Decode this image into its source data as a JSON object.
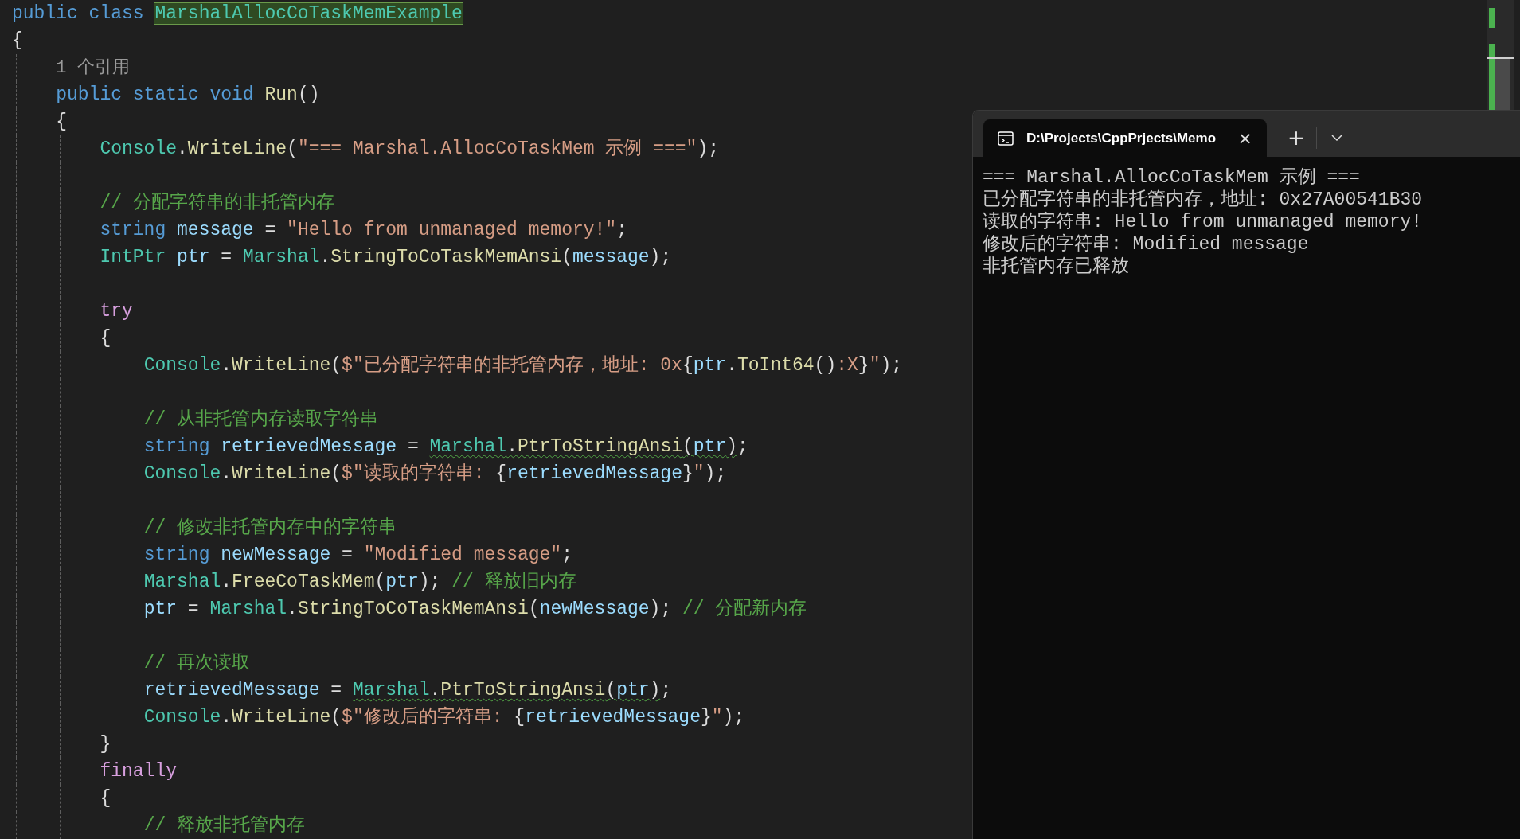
{
  "editor": {
    "lines": [
      {
        "kind": "code",
        "tokens": [
          {
            "kind": "kw",
            "text": "public class "
          },
          {
            "kind": "type",
            "text": "MarshalAllocCoTaskMemExample",
            "highlighted": true
          }
        ]
      },
      {
        "kind": "code",
        "tokens": [
          {
            "kind": "plain",
            "text": "{"
          }
        ],
        "children": [
          {
            "kind": "codelens",
            "text": "1 个引用"
          },
          {
            "kind": "code",
            "tokens": [
              {
                "kind": "kw",
                "text": "public static void "
              },
              {
                "kind": "fn",
                "text": "Run"
              },
              {
                "kind": "plain",
                "text": "()"
              }
            ]
          },
          {
            "kind": "code",
            "tokens": [
              {
                "kind": "plain",
                "text": "{"
              }
            ],
            "children": [
              {
                "kind": "code",
                "tokens": [
                  {
                    "kind": "type",
                    "text": "Console"
                  },
                  {
                    "kind": "plain",
                    "text": "."
                  },
                  {
                    "kind": "fn",
                    "text": "WriteLine"
                  },
                  {
                    "kind": "plain",
                    "text": "("
                  },
                  {
                    "kind": "str",
                    "text": "\"=== Marshal.AllocCoTaskMem 示例 ===\""
                  },
                  {
                    "kind": "plain",
                    "text": ");"
                  }
                ]
              },
              {
                "kind": "blank"
              },
              {
                "kind": "code",
                "tokens": [
                  {
                    "kind": "cmt",
                    "text": "// 分配字符串的非托管内存"
                  }
                ]
              },
              {
                "kind": "code",
                "tokens": [
                  {
                    "kind": "kw",
                    "text": "string "
                  },
                  {
                    "kind": "var",
                    "text": "message"
                  },
                  {
                    "kind": "plain",
                    "text": " = "
                  },
                  {
                    "kind": "str",
                    "text": "\"Hello from unmanaged memory!\""
                  },
                  {
                    "kind": "plain",
                    "text": ";"
                  }
                ]
              },
              {
                "kind": "code",
                "tokens": [
                  {
                    "kind": "type",
                    "text": "IntPtr "
                  },
                  {
                    "kind": "var",
                    "text": "ptr"
                  },
                  {
                    "kind": "plain",
                    "text": " = "
                  },
                  {
                    "kind": "type",
                    "text": "Marshal"
                  },
                  {
                    "kind": "plain",
                    "text": "."
                  },
                  {
                    "kind": "fn",
                    "text": "StringToCoTaskMemAnsi"
                  },
                  {
                    "kind": "plain",
                    "text": "("
                  },
                  {
                    "kind": "var",
                    "text": "message"
                  },
                  {
                    "kind": "plain",
                    "text": ");"
                  }
                ]
              },
              {
                "kind": "blank"
              },
              {
                "kind": "code",
                "tokens": [
                  {
                    "kind": "ctl",
                    "text": "try"
                  }
                ]
              },
              {
                "kind": "code",
                "tokens": [
                  {
                    "kind": "plain",
                    "text": "{"
                  }
                ],
                "children": [
                  {
                    "kind": "code",
                    "tokens": [
                      {
                        "kind": "type",
                        "text": "Console"
                      },
                      {
                        "kind": "plain",
                        "text": "."
                      },
                      {
                        "kind": "fn",
                        "text": "WriteLine"
                      },
                      {
                        "kind": "plain",
                        "text": "("
                      },
                      {
                        "kind": "str",
                        "text": "$\"已分配字符串的非托管内存，地址: 0x"
                      },
                      {
                        "kind": "plain",
                        "text": "{"
                      },
                      {
                        "kind": "var",
                        "text": "ptr"
                      },
                      {
                        "kind": "plain",
                        "text": "."
                      },
                      {
                        "kind": "fn",
                        "text": "ToInt64"
                      },
                      {
                        "kind": "plain",
                        "text": "()"
                      },
                      {
                        "kind": "str",
                        "text": ":X"
                      },
                      {
                        "kind": "plain",
                        "text": "}"
                      },
                      {
                        "kind": "str",
                        "text": "\""
                      },
                      {
                        "kind": "plain",
                        "text": ");"
                      }
                    ]
                  },
                  {
                    "kind": "blank"
                  },
                  {
                    "kind": "code",
                    "tokens": [
                      {
                        "kind": "cmt",
                        "text": "// 从非托管内存读取字符串"
                      }
                    ]
                  },
                  {
                    "kind": "code",
                    "tokens": [
                      {
                        "kind": "kw",
                        "text": "string "
                      },
                      {
                        "kind": "var",
                        "text": "retrievedMessage"
                      },
                      {
                        "kind": "plain",
                        "text": " = "
                      },
                      {
                        "kind": "type",
                        "text": "Marshal",
                        "squiggle": true
                      },
                      {
                        "kind": "plain",
                        "text": ".",
                        "squiggle": true
                      },
                      {
                        "kind": "fn",
                        "text": "PtrToStringAnsi",
                        "squiggle": true
                      },
                      {
                        "kind": "plain",
                        "text": "(",
                        "squiggle": true
                      },
                      {
                        "kind": "var",
                        "text": "ptr",
                        "squiggle": true
                      },
                      {
                        "kind": "plain",
                        "text": ")",
                        "squiggle": true
                      },
                      {
                        "kind": "plain",
                        "text": ";"
                      }
                    ]
                  },
                  {
                    "kind": "code",
                    "tokens": [
                      {
                        "kind": "type",
                        "text": "Console"
                      },
                      {
                        "kind": "plain",
                        "text": "."
                      },
                      {
                        "kind": "fn",
                        "text": "WriteLine"
                      },
                      {
                        "kind": "plain",
                        "text": "("
                      },
                      {
                        "kind": "str",
                        "text": "$\"读取的字符串: "
                      },
                      {
                        "kind": "plain",
                        "text": "{"
                      },
                      {
                        "kind": "var",
                        "text": "retrievedMessage"
                      },
                      {
                        "kind": "plain",
                        "text": "}"
                      },
                      {
                        "kind": "str",
                        "text": "\""
                      },
                      {
                        "kind": "plain",
                        "text": ");"
                      }
                    ]
                  },
                  {
                    "kind": "blank"
                  },
                  {
                    "kind": "code",
                    "tokens": [
                      {
                        "kind": "cmt",
                        "text": "// 修改非托管内存中的字符串"
                      }
                    ]
                  },
                  {
                    "kind": "code",
                    "tokens": [
                      {
                        "kind": "kw",
                        "text": "string "
                      },
                      {
                        "kind": "var",
                        "text": "newMessage"
                      },
                      {
                        "kind": "plain",
                        "text": " = "
                      },
                      {
                        "kind": "str",
                        "text": "\"Modified message\""
                      },
                      {
                        "kind": "plain",
                        "text": ";"
                      }
                    ]
                  },
                  {
                    "kind": "code",
                    "tokens": [
                      {
                        "kind": "type",
                        "text": "Marshal"
                      },
                      {
                        "kind": "plain",
                        "text": "."
                      },
                      {
                        "kind": "fn",
                        "text": "FreeCoTaskMem"
                      },
                      {
                        "kind": "plain",
                        "text": "("
                      },
                      {
                        "kind": "var",
                        "text": "ptr"
                      },
                      {
                        "kind": "plain",
                        "text": "); "
                      },
                      {
                        "kind": "cmt",
                        "text": "// 释放旧内存"
                      }
                    ]
                  },
                  {
                    "kind": "code",
                    "tokens": [
                      {
                        "kind": "var",
                        "text": "ptr"
                      },
                      {
                        "kind": "plain",
                        "text": " = "
                      },
                      {
                        "kind": "type",
                        "text": "Marshal"
                      },
                      {
                        "kind": "plain",
                        "text": "."
                      },
                      {
                        "kind": "fn",
                        "text": "StringToCoTaskMemAnsi"
                      },
                      {
                        "kind": "plain",
                        "text": "("
                      },
                      {
                        "kind": "var",
                        "text": "newMessage"
                      },
                      {
                        "kind": "plain",
                        "text": "); "
                      },
                      {
                        "kind": "cmt",
                        "text": "// 分配新内存"
                      }
                    ]
                  },
                  {
                    "kind": "blank"
                  },
                  {
                    "kind": "code",
                    "tokens": [
                      {
                        "kind": "cmt",
                        "text": "// 再次读取"
                      }
                    ]
                  },
                  {
                    "kind": "code",
                    "tokens": [
                      {
                        "kind": "var",
                        "text": "retrievedMessage"
                      },
                      {
                        "kind": "plain",
                        "text": " = "
                      },
                      {
                        "kind": "type",
                        "text": "Marshal",
                        "squiggle": true
                      },
                      {
                        "kind": "plain",
                        "text": ".",
                        "squiggle": true
                      },
                      {
                        "kind": "fn",
                        "text": "PtrToStringAnsi",
                        "squiggle": true
                      },
                      {
                        "kind": "plain",
                        "text": "(",
                        "squiggle": true
                      },
                      {
                        "kind": "var",
                        "text": "ptr",
                        "squiggle": true
                      },
                      {
                        "kind": "plain",
                        "text": ")",
                        "squiggle": true
                      },
                      {
                        "kind": "plain",
                        "text": ";"
                      }
                    ]
                  },
                  {
                    "kind": "code",
                    "tokens": [
                      {
                        "kind": "type",
                        "text": "Console"
                      },
                      {
                        "kind": "plain",
                        "text": "."
                      },
                      {
                        "kind": "fn",
                        "text": "WriteLine"
                      },
                      {
                        "kind": "plain",
                        "text": "("
                      },
                      {
                        "kind": "str",
                        "text": "$\"修改后的字符串: "
                      },
                      {
                        "kind": "plain",
                        "text": "{"
                      },
                      {
                        "kind": "var",
                        "text": "retrievedMessage"
                      },
                      {
                        "kind": "plain",
                        "text": "}"
                      },
                      {
                        "kind": "str",
                        "text": "\""
                      },
                      {
                        "kind": "plain",
                        "text": ");"
                      }
                    ]
                  }
                ]
              },
              {
                "kind": "code",
                "tokens": [
                  {
                    "kind": "plain",
                    "text": "}"
                  }
                ]
              },
              {
                "kind": "code",
                "tokens": [
                  {
                    "kind": "ctl",
                    "text": "finally"
                  }
                ]
              },
              {
                "kind": "code",
                "tokens": [
                  {
                    "kind": "plain",
                    "text": "{"
                  }
                ],
                "children": [
                  {
                    "kind": "code",
                    "tokens": [
                      {
                        "kind": "cmt",
                        "text": "// 释放非托管内存"
                      }
                    ]
                  }
                ]
              }
            ]
          }
        ]
      }
    ]
  },
  "terminal": {
    "tab": {
      "title": "D:\\Projects\\CppPrjects\\Memo",
      "close": "×",
      "selected": true
    },
    "new_tab": "+",
    "output": [
      "=== Marshal.AllocCoTaskMem 示例 ===",
      "已分配字符串的非托管内存，地址: 0x27A00541B30",
      "读取的字符串: Hello from unmanaged memory!",
      "修改后的字符串: Modified message",
      "非托管内存已释放"
    ]
  }
}
